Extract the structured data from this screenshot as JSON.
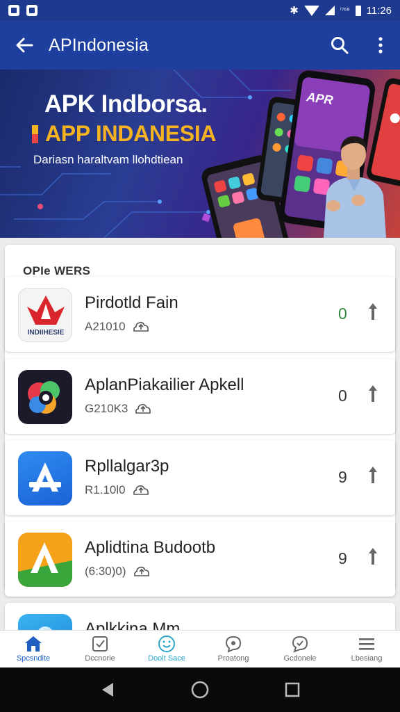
{
  "status_bar": {
    "signal_text": "ⁱ⁷⁶⁸",
    "time": "11:26"
  },
  "app_bar": {
    "title": "APIndonesia"
  },
  "banner": {
    "headline": "APK Indborsa.",
    "subheadline": "APP INDANESIA",
    "tagline": "Dariasn haraltvam llohdtiean",
    "phone_label": "APR"
  },
  "section": {
    "title": "OPIe WERS",
    "apps": [
      {
        "name": "Pirdotld Fain",
        "meta": "A21010",
        "count": "0",
        "count_color": "#2e8b3e",
        "icon": "indonesia-icon",
        "icon_text": "INDIIHESIE"
      },
      {
        "name": "AplanPiakailier Apkell",
        "meta": "G210K3",
        "count": "0",
        "count_color": "#333333",
        "icon": "colorful-camera-icon"
      },
      {
        "name": "Rpllalgar3p",
        "meta": "R1.10l0",
        "count": "9",
        "count_color": "#333333",
        "icon": "app-store-icon"
      },
      {
        "name": "Aplidtina Budootb",
        "meta": "(6:30)0)",
        "count": "9",
        "count_color": "#333333",
        "icon": "green-a-icon"
      },
      {
        "name": "Aplkkina Mm",
        "meta": "",
        "count": "",
        "icon": "blue-app-icon"
      }
    ]
  },
  "bottom_nav": [
    {
      "label": "Spcsndite",
      "icon": "home-icon"
    },
    {
      "label": "Dccnorie",
      "icon": "check-square-icon"
    },
    {
      "label": "Doolt Sace",
      "icon": "smiley-icon"
    },
    {
      "label": "Proatong",
      "icon": "chat-icon"
    },
    {
      "label": "Gcdonele",
      "icon": "support-icon"
    },
    {
      "label": "Lbesiang",
      "icon": "menu-icon"
    }
  ]
}
